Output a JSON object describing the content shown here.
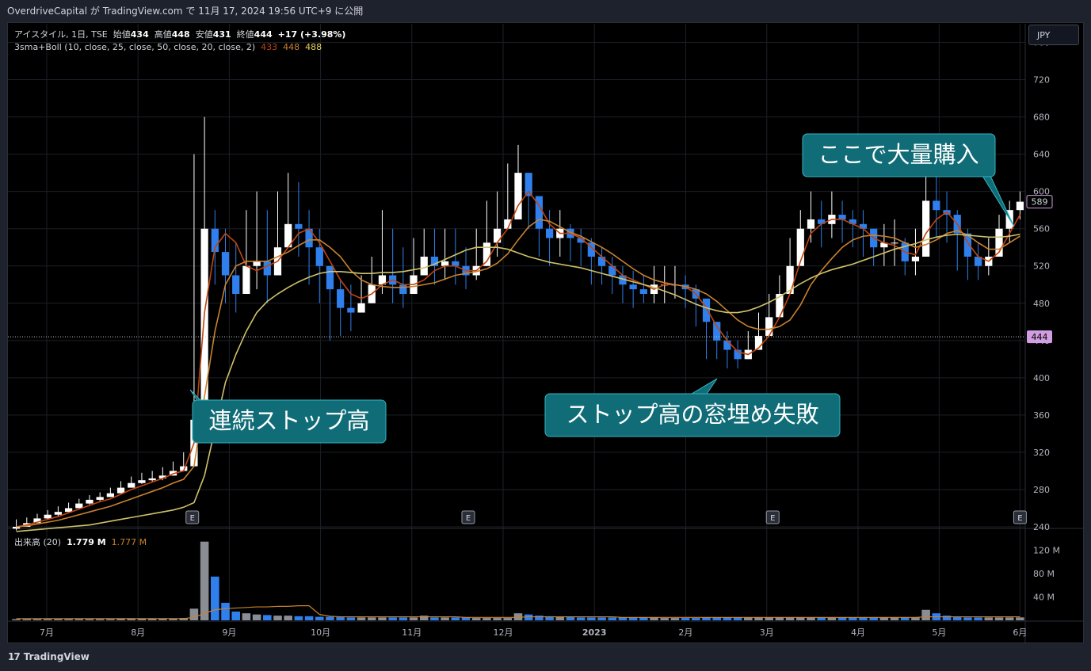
{
  "header": {
    "published": "OverdriveCapital が TradingView.com で 11月 17, 2024 19:56 UTC+9 に公開"
  },
  "legend": {
    "symbol": "アイスタイル, 1日, TSE",
    "open_label": "始値",
    "open": "434",
    "high_label": "高値",
    "high": "448",
    "low_label": "安値",
    "low": "431",
    "close_label": "終値",
    "close": "444",
    "change": "+17 (+3.98%)",
    "indicator": "3sma+Boll (10, close, 25, close, 50, close, 20, close, 2)",
    "sma10": "433",
    "sma25": "448",
    "sma50": "488",
    "volume_label": "出来高 (20)",
    "volume": "1.779 M",
    "volume_ma": "1.777 M"
  },
  "currency": "JPY",
  "current_price_label": "444",
  "last_price_label": "589",
  "brand": "TradingView",
  "annotations": {
    "a1": "連続ストップ高",
    "a2": "ストップ高の窓埋め失敗",
    "a3": "ここで大量購入"
  },
  "earnings_marker": "E",
  "colors": {
    "up": "#ffffff",
    "down": "#2f80ed",
    "sma10": "#c1440e",
    "sma25": "#c9822e",
    "sma50": "#cfc26a",
    "callout": "#106c77",
    "price_tag": "#d19ee2"
  },
  "chart_data": {
    "type": "candlestick",
    "price_axis": {
      "min": 240,
      "max": 780,
      "ticks": [
        240,
        280,
        320,
        360,
        400,
        440,
        480,
        520,
        560,
        600,
        640,
        680,
        720,
        760
      ]
    },
    "volume_axis": {
      "min": 0,
      "max": 140,
      "unit": "M",
      "ticks": [
        40,
        80,
        120
      ],
      "tick_labels": [
        "40 M",
        "80 M",
        "120 M"
      ]
    },
    "time_labels": [
      "7月",
      "8月",
      "9月",
      "10月",
      "11月",
      "12月",
      "2023",
      "2月",
      "3月",
      "4月",
      "5月",
      "6月"
    ],
    "earnings_weeks": [
      37,
      95,
      159,
      211
    ],
    "weekly_close": [
      240,
      244,
      249,
      253,
      256,
      260,
      265,
      269,
      272,
      276,
      282,
      287,
      290,
      292,
      295,
      300,
      305,
      355,
      560,
      535,
      510,
      490,
      520,
      525,
      510,
      540,
      565,
      560,
      540,
      520,
      495,
      475,
      470,
      480,
      500,
      510,
      500,
      490,
      510,
      530,
      520,
      525,
      520,
      510,
      520,
      545,
      560,
      570,
      620,
      595,
      560,
      550,
      560,
      550,
      545,
      530,
      520,
      510,
      500,
      495,
      490,
      500,
      500,
      500,
      495,
      485,
      460,
      440,
      430,
      420,
      430,
      445,
      465,
      490,
      520,
      560,
      570,
      565,
      575,
      570,
      565,
      560,
      540,
      545,
      545,
      525,
      530,
      590,
      580,
      575,
      555,
      530,
      520,
      530,
      560,
      580,
      589
    ],
    "weekly_high": [
      248,
      250,
      254,
      258,
      262,
      266,
      270,
      274,
      277,
      282,
      289,
      294,
      298,
      300,
      304,
      310,
      320,
      640,
      680,
      580,
      560,
      545,
      580,
      600,
      580,
      600,
      620,
      610,
      580,
      560,
      520,
      505,
      500,
      510,
      530,
      580,
      560,
      540,
      550,
      560,
      560,
      560,
      560,
      540,
      560,
      590,
      600,
      630,
      650,
      610,
      590,
      580,
      580,
      565,
      560,
      550,
      540,
      530,
      520,
      515,
      510,
      520,
      520,
      520,
      510,
      500,
      480,
      460,
      450,
      440,
      450,
      470,
      490,
      510,
      550,
      580,
      600,
      590,
      600,
      590,
      580,
      580,
      560,
      565,
      570,
      550,
      560,
      630,
      620,
      600,
      580,
      560,
      545,
      550,
      575,
      590,
      600
    ],
    "weekly_low": [
      236,
      240,
      245,
      248,
      251,
      256,
      260,
      264,
      267,
      272,
      278,
      283,
      286,
      288,
      290,
      295,
      300,
      350,
      530,
      500,
      480,
      470,
      490,
      495,
      480,
      510,
      540,
      530,
      500,
      480,
      440,
      445,
      450,
      470,
      480,
      490,
      480,
      475,
      495,
      510,
      500,
      505,
      500,
      495,
      505,
      520,
      530,
      560,
      580,
      560,
      530,
      520,
      530,
      525,
      520,
      500,
      500,
      490,
      480,
      475,
      480,
      480,
      480,
      485,
      475,
      455,
      420,
      420,
      410,
      410,
      420,
      430,
      445,
      470,
      490,
      530,
      545,
      540,
      550,
      545,
      540,
      530,
      520,
      520,
      520,
      510,
      510,
      560,
      550,
      545,
      515,
      505,
      505,
      510,
      535,
      545,
      570
    ],
    "sma10": [
      240,
      242,
      245,
      248,
      251,
      255,
      259,
      263,
      267,
      270,
      275,
      280,
      284,
      288,
      292,
      297,
      300,
      330,
      470,
      540,
      555,
      545,
      520,
      515,
      520,
      525,
      540,
      555,
      560,
      545,
      525,
      505,
      490,
      485,
      490,
      500,
      505,
      500,
      500,
      505,
      515,
      520,
      520,
      515,
      515,
      525,
      545,
      560,
      585,
      600,
      585,
      565,
      555,
      555,
      550,
      540,
      530,
      520,
      510,
      505,
      500,
      495,
      500,
      500,
      498,
      490,
      475,
      455,
      440,
      428,
      425,
      432,
      445,
      465,
      490,
      525,
      555,
      565,
      570,
      570,
      565,
      560,
      550,
      545,
      542,
      535,
      532,
      555,
      570,
      578,
      565,
      545,
      530,
      525,
      535,
      555,
      575
    ],
    "sma25": [
      240,
      241,
      243,
      245,
      247,
      250,
      253,
      256,
      259,
      262,
      266,
      270,
      274,
      278,
      282,
      287,
      291,
      305,
      380,
      450,
      500,
      520,
      525,
      525,
      525,
      530,
      535,
      542,
      548,
      548,
      540,
      530,
      515,
      505,
      500,
      498,
      497,
      497,
      498,
      500,
      502,
      506,
      510,
      512,
      514,
      517,
      523,
      533,
      548,
      562,
      570,
      568,
      562,
      556,
      552,
      546,
      540,
      533,
      525,
      517,
      510,
      505,
      502,
      500,
      498,
      495,
      490,
      482,
      472,
      462,
      455,
      452,
      452,
      455,
      462,
      478,
      500,
      515,
      528,
      540,
      548,
      552,
      553,
      552,
      550,
      545,
      540,
      543,
      548,
      555,
      558,
      553,
      545,
      538,
      538,
      545,
      552
    ],
    "sma50": [
      235,
      236,
      237,
      238,
      239,
      240,
      241,
      242,
      244,
      246,
      248,
      250,
      252,
      254,
      256,
      258,
      261,
      266,
      295,
      345,
      395,
      425,
      450,
      470,
      482,
      490,
      497,
      503,
      508,
      512,
      514,
      514,
      513,
      512,
      512,
      513,
      513,
      514,
      516,
      518,
      522,
      527,
      532,
      537,
      540,
      540,
      540,
      538,
      534,
      530,
      527,
      524,
      522,
      520,
      518,
      515,
      512,
      509,
      506,
      503,
      500,
      497,
      493,
      489,
      484,
      479,
      475,
      472,
      470,
      470,
      472,
      476,
      481,
      487,
      494,
      501,
      507,
      512,
      516,
      519,
      522,
      526,
      530,
      534,
      538,
      541,
      544,
      548,
      551,
      553,
      554,
      553,
      552,
      551,
      551,
      552,
      554
    ],
    "weekly_volume": [
      2,
      2,
      2,
      2,
      2,
      2,
      2,
      2,
      2,
      2,
      3,
      3,
      3,
      3,
      3,
      3,
      4,
      20,
      135,
      75,
      30,
      15,
      12,
      10,
      9,
      8,
      8,
      7,
      7,
      6,
      6,
      6,
      5,
      5,
      5,
      5,
      5,
      5,
      5,
      8,
      5,
      5,
      5,
      5,
      4,
      4,
      4,
      4,
      12,
      10,
      8,
      7,
      6,
      6,
      5,
      5,
      5,
      5,
      5,
      5,
      5,
      5,
      4,
      4,
      4,
      4,
      5,
      5,
      5,
      5,
      5,
      5,
      5,
      5,
      5,
      5,
      5,
      5,
      5,
      5,
      5,
      5,
      5,
      5,
      5,
      5,
      5,
      18,
      12,
      8,
      6,
      5,
      5,
      5,
      5,
      5,
      5
    ],
    "volume_ma": [
      3,
      3,
      3,
      3,
      3,
      3,
      3,
      3,
      3,
      3,
      3,
      3,
      3,
      3,
      3,
      3,
      3,
      5,
      12,
      18,
      20,
      21,
      22,
      23,
      23,
      24,
      24,
      25,
      25,
      10,
      7,
      6,
      6,
      6,
      6,
      6,
      6,
      6,
      6,
      6,
      6,
      6,
      6,
      5,
      5,
      5,
      5,
      5,
      5,
      6,
      6,
      6,
      6,
      6,
      6,
      6,
      6,
      6,
      5,
      5,
      5,
      5,
      5,
      5,
      5,
      5,
      5,
      5,
      5,
      5,
      5,
      5,
      5,
      5,
      5,
      5,
      5,
      5,
      5,
      5,
      5,
      5,
      5,
      5,
      5,
      5,
      5,
      6,
      6,
      6,
      6,
      6,
      6,
      6,
      6,
      6,
      6
    ]
  }
}
